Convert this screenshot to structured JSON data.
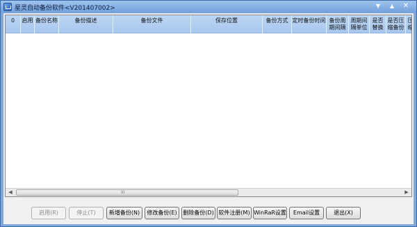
{
  "window": {
    "title": "星灵自动备份软件<V201407002>",
    "controls": [
      "minimize-icon",
      "maximize-icon",
      "close-icon"
    ]
  },
  "grid": {
    "columns": [
      "0",
      "启用",
      "备份名称",
      "备份描述",
      "备份文件",
      "保存位置",
      "备份方式",
      "定时备份时间",
      "备份周期间隔",
      "周期间隔单位",
      "是否替换",
      "是否压缩备份",
      "压缩"
    ],
    "rows": [],
    "scrollbar": {
      "left_arrow": "◀",
      "right_arrow": "▶",
      "grip": "III"
    }
  },
  "buttons": {
    "enable": "启用(R)",
    "stop": "停止(T)",
    "add": "新增备份(N)",
    "edit": "修改备份(E)",
    "delete": "删除备份(D)",
    "register": "软件注册(M)",
    "winrar": "WinRaR设置",
    "email": "Email设置",
    "exit": "退出(X)"
  }
}
